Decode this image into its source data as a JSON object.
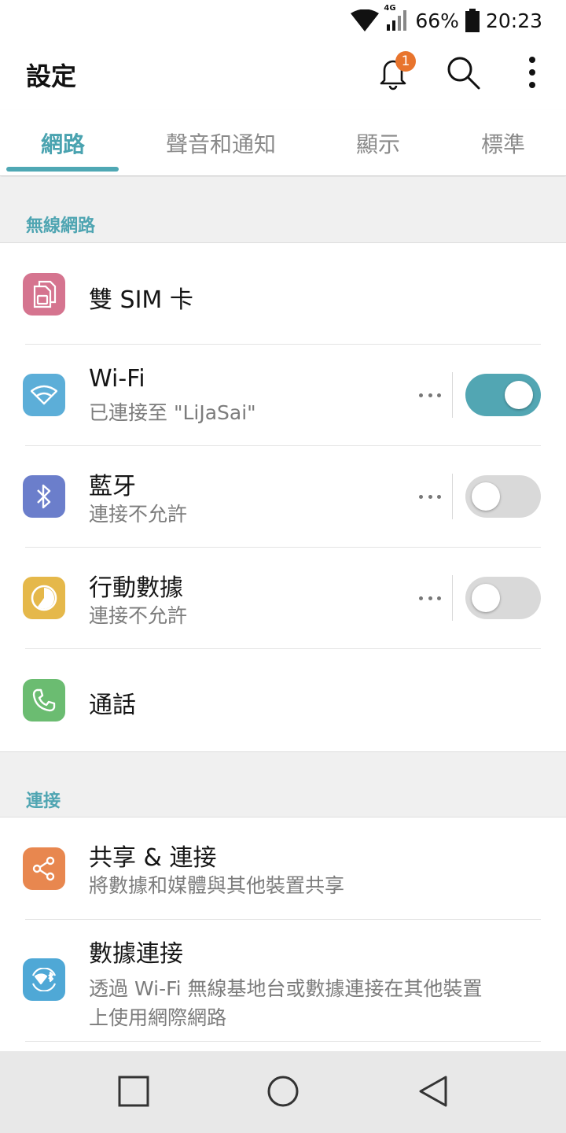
{
  "status_bar": {
    "network_type": "4G",
    "battery_percent": "66%",
    "time": "20:23"
  },
  "header": {
    "title": "設定",
    "notification_count": "1",
    "icons": [
      "bell-icon",
      "search-icon",
      "more-vert-icon"
    ]
  },
  "tabs": [
    {
      "label": "網路",
      "active": true
    },
    {
      "label": "聲音和通知",
      "active": false
    },
    {
      "label": "顯示",
      "active": false
    },
    {
      "label": "標準",
      "active": false
    }
  ],
  "sections": {
    "wireless": {
      "label": "無線網路",
      "items": [
        {
          "title": "雙 SIM 卡",
          "icon": "dual-sim-icon",
          "color": "#d5748f"
        },
        {
          "title": "Wi-Fi",
          "subtitle": "已連接至 \"LiJaSai\"",
          "icon": "wifi-icon",
          "color": "#5caed8",
          "toggle": true
        },
        {
          "title": "藍牙",
          "subtitle": "連接不允許",
          "icon": "bluetooth-icon",
          "color": "#6b7ecb",
          "toggle": false
        },
        {
          "title": "行動數據",
          "subtitle": "連接不允許",
          "icon": "mobile-data-icon",
          "color": "#e5b84a",
          "toggle": false
        },
        {
          "title": "通話",
          "icon": "phone-icon",
          "color": "#6bbc71"
        }
      ]
    },
    "connectivity": {
      "label": "連接",
      "items": [
        {
          "title": "共享 & 連接",
          "subtitle": "將數據和媒體與其他裝置共享",
          "icon": "share-icon",
          "color": "#e8874f"
        },
        {
          "title": "數據連接",
          "subtitle_line1": "透過 Wi-Fi 無線基地台或數據連接在其他裝置",
          "subtitle_line2": "上使用網際網路",
          "icon": "tethering-icon",
          "color": "#4fa8d6"
        }
      ]
    }
  },
  "nav_bar": {
    "icons": [
      "recents-icon",
      "home-icon",
      "back-icon"
    ]
  },
  "colors": {
    "accent": "#4fa8b4",
    "badge": "#e8742d"
  }
}
